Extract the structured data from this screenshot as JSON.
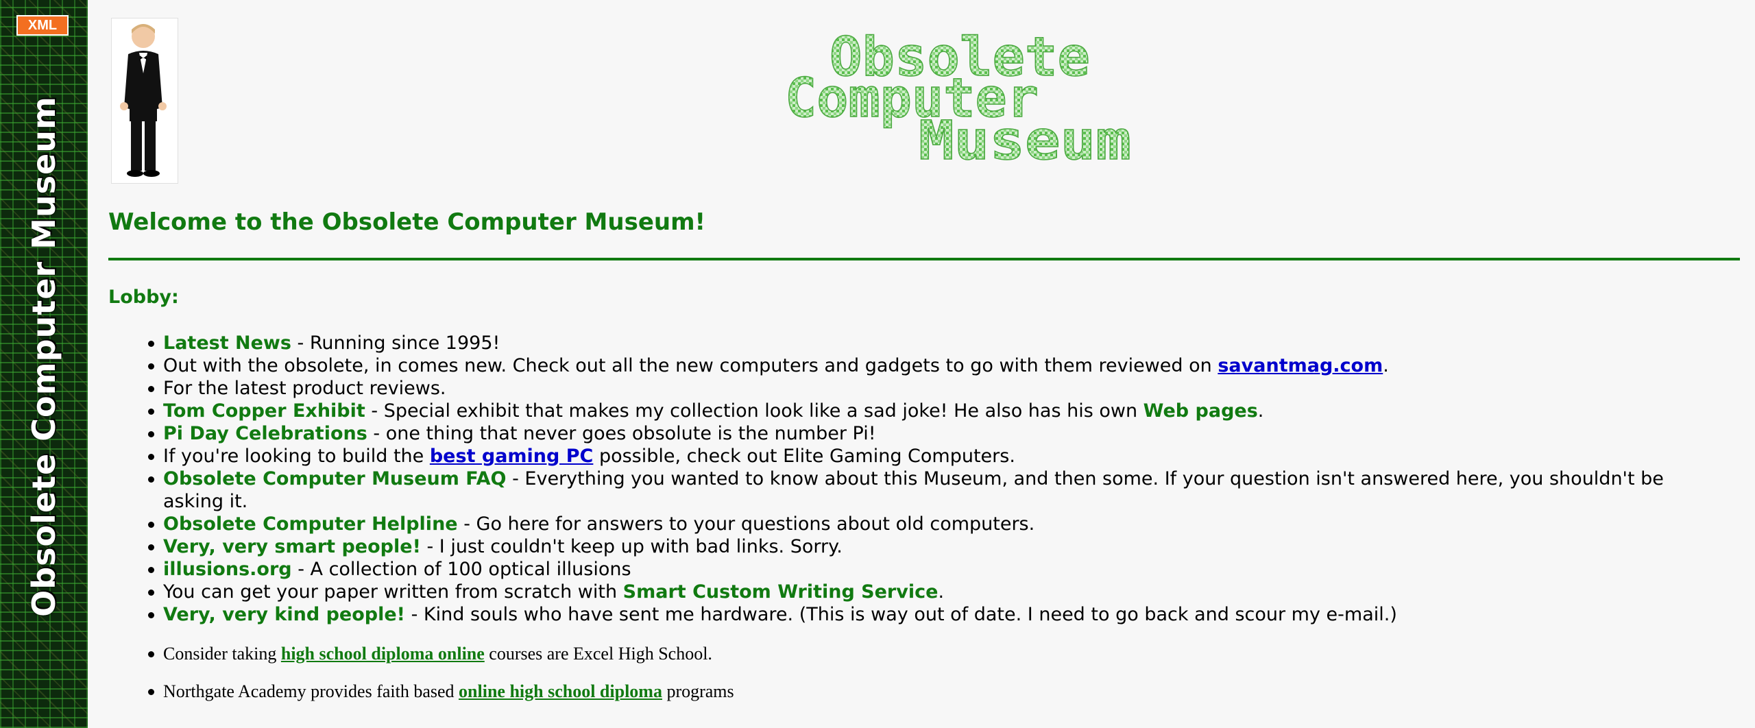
{
  "sidebar": {
    "xml_badge": "XML",
    "title": "Obsolete Computer Museum"
  },
  "logo": {
    "line1": "Obsolete",
    "line2": "Computer",
    "line3": "Museum"
  },
  "welcome": "Welcome to the Obsolete Computer Museum!",
  "lobby": "Lobby:",
  "items": [
    {
      "link": "Latest News",
      "text": " - Running since 1995!"
    },
    {
      "pre": "Out with the obsolete, in comes new. Check out all the new computers and gadgets to go with them reviewed on ",
      "link": "savantmag.com",
      "post": "."
    },
    {
      "text": "For the latest product reviews."
    },
    {
      "link": "Tom Copper Exhibit",
      "text": " - Special exhibit that makes my collection look like a sad joke! He also has his own ",
      "link2": "Web pages",
      "post": "."
    },
    {
      "link": "Pi Day Celebrations",
      "text": " - one thing that never goes obsolute is the number Pi!"
    },
    {
      "pre": "If you're looking to build the ",
      "link": "best gaming PC",
      "post": " possible, check out Elite Gaming Computers."
    },
    {
      "link": "Obsolete Computer Museum FAQ",
      "text": " - Everything you wanted to know about this Museum, and then some. If your question isn't answered here, you shouldn't be asking it."
    },
    {
      "link": "Obsolete Computer Helpline",
      "text": " - Go here for answers to your questions about old computers."
    },
    {
      "link": "Very, very smart people!",
      "text": " - I just couldn't keep up with bad links. Sorry."
    },
    {
      "link": "illusions.org",
      "text": " - A collection of 100 optical illusions"
    },
    {
      "pre": "You can get your paper written from scratch with ",
      "link": "Smart Custom Writing Service",
      "post": "."
    },
    {
      "link": "Very, very kind people!",
      "text": " - Kind souls who have sent me hardware. (This is way out of date. I need to go back and scour my e-mail.)"
    }
  ],
  "items2": [
    {
      "pre": "Consider taking ",
      "link": "high school diploma online",
      "post": " courses are Excel High School."
    },
    {
      "pre": "Northgate Academy provides faith based ",
      "link": "online high school diploma",
      "post": " programs"
    }
  ],
  "colors": {
    "brand_green": "#117a11",
    "link_blue": "#0000cc",
    "xml_orange": "#f36f21"
  }
}
